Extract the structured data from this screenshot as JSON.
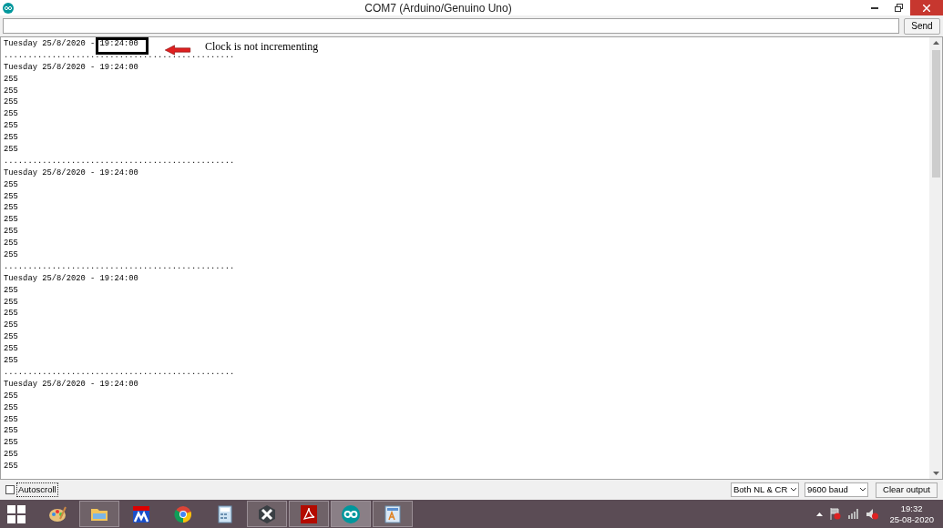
{
  "window": {
    "title": "COM7 (Arduino/Genuino Uno)"
  },
  "send_bar": {
    "button": "Send"
  },
  "output": {
    "first_line": {
      "text": "Tuesday 25/8/2020 - ",
      "boxed": "19:24:00"
    },
    "lines": [
      "................................................",
      "Tuesday 25/8/2020 - 19:24:00",
      "255",
      "255",
      "255",
      "255",
      "255",
      "255",
      "255",
      "................................................",
      "Tuesday 25/8/2020 - 19:24:00",
      "255",
      "255",
      "255",
      "255",
      "255",
      "255",
      "255",
      "................................................",
      "Tuesday 25/8/2020 - 19:24:00",
      "255",
      "255",
      "255",
      "255",
      "255",
      "255",
      "255",
      "................................................",
      "Tuesday 25/8/2020 - 19:24:00",
      "255",
      "255",
      "255",
      "255",
      "255",
      "255",
      "255"
    ]
  },
  "annotation": {
    "text": "Clock is not incrementing"
  },
  "footer": {
    "autoscroll": {
      "label": "Autoscroll",
      "checked": false
    },
    "line_ending": "Both NL & CR",
    "baud": "9600 baud",
    "clear_button": "Clear output"
  },
  "taskbar": {
    "apps": [
      {
        "kind": "paint",
        "running": false,
        "selected": false
      },
      {
        "kind": "folder",
        "running": true,
        "selected": false
      },
      {
        "kind": "chip",
        "running": false,
        "selected": false
      },
      {
        "kind": "browser",
        "running": false,
        "selected": false
      },
      {
        "kind": "calculator",
        "running": false,
        "selected": false
      },
      {
        "kind": "x",
        "running": true,
        "selected": false
      },
      {
        "kind": "pdf",
        "running": true,
        "selected": false
      },
      {
        "kind": "arduino",
        "running": true,
        "selected": true
      },
      {
        "kind": "document",
        "running": true,
        "selected": false
      }
    ]
  },
  "clock": {
    "time": "19:32",
    "date": "25-08-2020"
  }
}
